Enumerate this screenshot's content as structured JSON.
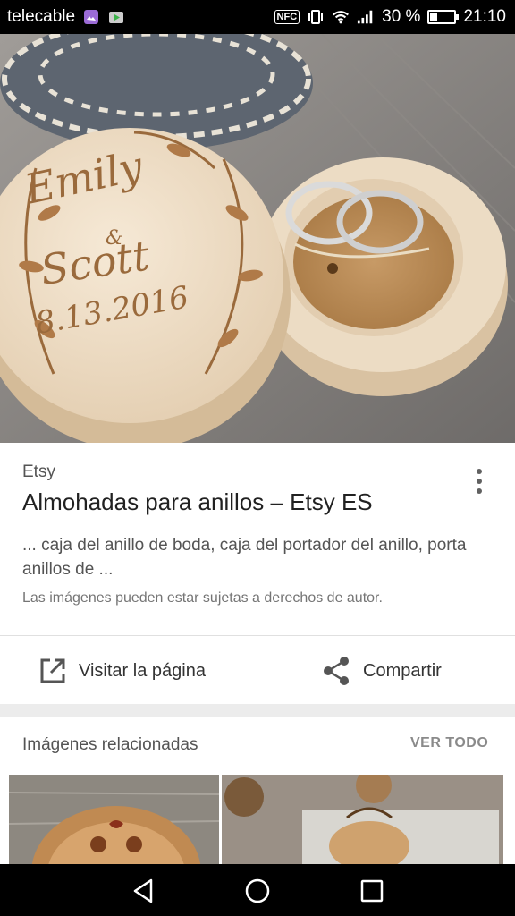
{
  "status_bar": {
    "carrier": "telecable",
    "nfc": "NFC",
    "battery_text": "30 %",
    "battery_level": 0.3,
    "time": "21:10",
    "icons": [
      "gallery-icon",
      "play-store-icon",
      "nfc-icon",
      "vibrate-icon",
      "wifi-icon",
      "signal-icon",
      "battery-icon"
    ]
  },
  "hero_image": {
    "engraving": {
      "name1": "Emily",
      "amp": "&",
      "name2": "Scott",
      "date": "8.13.2016"
    }
  },
  "result": {
    "source": "Etsy",
    "title": "Almohadas para anillos – Etsy ES",
    "snippet": "... caja del anillo de boda, caja del portador del anillo, porta anillos de ...",
    "rights_notice": "Las imágenes pueden estar sujetas a derechos de autor.",
    "visit_label": "Visitar la página",
    "share_label": "Compartir"
  },
  "related": {
    "title": "Imágenes relacionadas",
    "view_all": "VER TODO"
  },
  "nav_bar": {
    "icons": [
      "back-icon",
      "home-icon",
      "recents-icon"
    ]
  }
}
